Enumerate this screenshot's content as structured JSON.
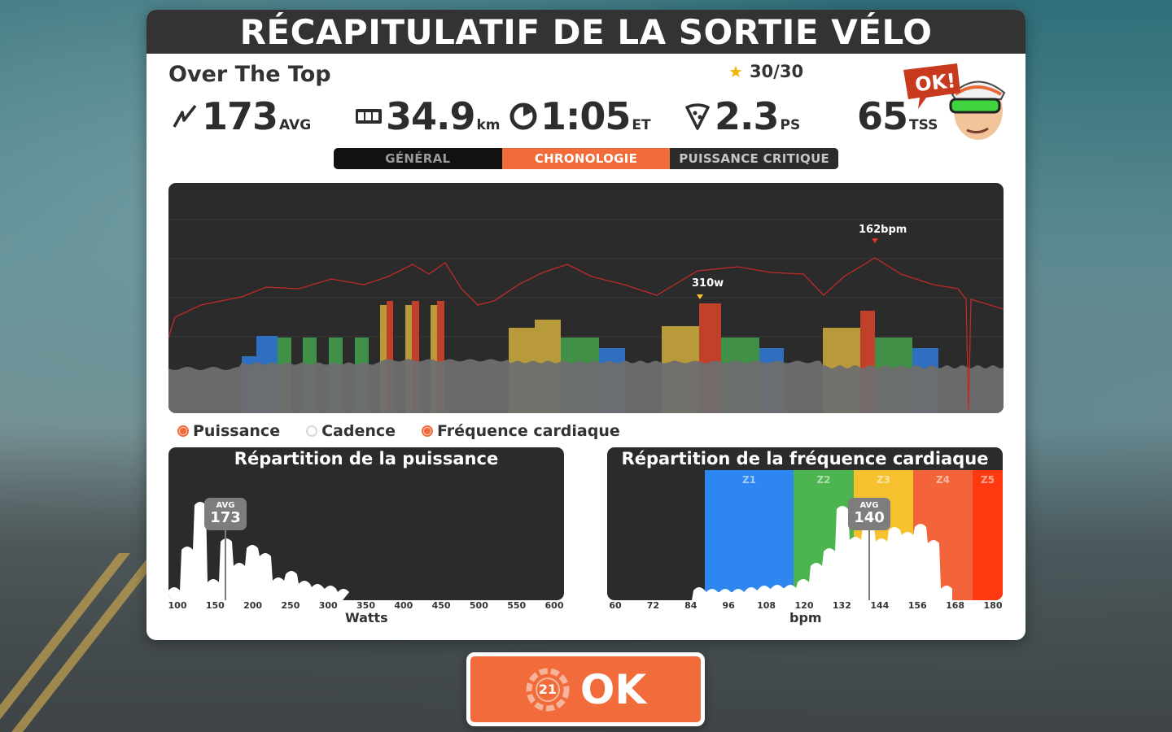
{
  "header": {
    "title": "RÉCAPITULATIF DE LA SORTIE VÉLO"
  },
  "ride": {
    "route_name": "Over The Top",
    "stars": "30/30"
  },
  "stats": [
    {
      "icon": "power-icon",
      "value": "173",
      "unit": "AVG"
    },
    {
      "icon": "odometer-icon",
      "value": "34.9",
      "unit": "km"
    },
    {
      "icon": "clock-icon",
      "value": "1:05",
      "unit": "ET"
    },
    {
      "icon": "pizza-icon",
      "value": "2.3",
      "unit": "PS"
    },
    {
      "icon": "",
      "value": "65",
      "unit": "TSS"
    }
  ],
  "coach": {
    "speech": "OK!"
  },
  "tabs": [
    {
      "label": "GÉNÉRAL",
      "active": false
    },
    {
      "label": "CHRONOLOGIE",
      "active": true
    },
    {
      "label": "PUISSANCE CRITIQUE",
      "active": false
    }
  ],
  "timeline": {
    "power_peak_label": "310w",
    "hr_peak_label": "162bpm"
  },
  "legend": [
    {
      "label": "Puissance",
      "on": true
    },
    {
      "label": "Cadence",
      "on": false
    },
    {
      "label": "Fréquence cardiaque",
      "on": true
    }
  ],
  "power_distribution": {
    "title": "Répartition de la puissance",
    "avg_label": "AVG",
    "avg_value": "173",
    "axis_title": "Watts",
    "ticks": [
      "100",
      "150",
      "200",
      "250",
      "300",
      "350",
      "400",
      "450",
      "500",
      "550",
      "600"
    ]
  },
  "hr_distribution": {
    "title": "Répartition de la fréquence cardiaque",
    "avg_label": "AVG",
    "avg_value": "140",
    "axis_title": "bpm",
    "ticks": [
      "60",
      "72",
      "84",
      "96",
      "108",
      "120",
      "132",
      "144",
      "156",
      "168",
      "180"
    ],
    "zones": [
      "Z1",
      "Z2",
      "Z3",
      "Z4",
      "Z5"
    ],
    "zone_colors": [
      "#2e86f0",
      "#4cb550",
      "#f5c12e",
      "#f3643a",
      "#ff3a10"
    ]
  },
  "ok_button": {
    "label": "OK",
    "countdown": "21"
  },
  "colors": {
    "accent": "#f26b3a",
    "zone_gray": "#6e6e6e",
    "zone_blue": "#2e6fc0",
    "zone_green": "#409048",
    "zone_yellow": "#b89a3a",
    "zone_orange": "#c4702e",
    "zone_red": "#c0402a",
    "hr_line": "#c02a2a"
  }
}
